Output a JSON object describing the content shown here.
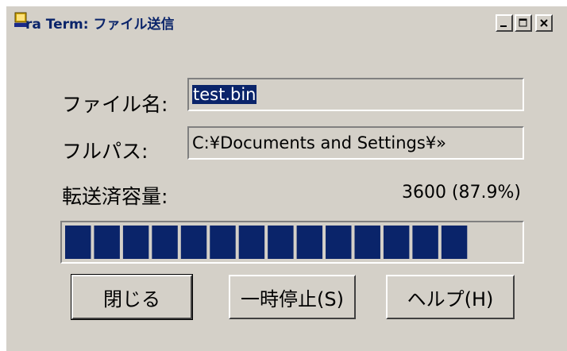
{
  "window": {
    "title": "ra Term: ファイル送信",
    "controls": {
      "minimize": "minimize-icon",
      "maximize": "maximize-icon",
      "close": "close-icon"
    }
  },
  "form": {
    "filename_label": "ファイル名:",
    "filename_value": "test.bin",
    "fullpath_label": "フルパス:",
    "fullpath_value": "C:¥Documents and Settings¥»",
    "transferred_label": "転送済容量:",
    "transferred_value": "3600 (87.9%)"
  },
  "progress": {
    "percent": 87.9,
    "blocks": 14,
    "color": "#0a246a"
  },
  "buttons": {
    "close_label": "閉じる",
    "pause_label": "一時停止(S)",
    "help_label": "ヘルプ(H)"
  },
  "colors": {
    "face": "#d4d0c8",
    "title_text": "#0a246a",
    "selection": "#0a246a"
  }
}
